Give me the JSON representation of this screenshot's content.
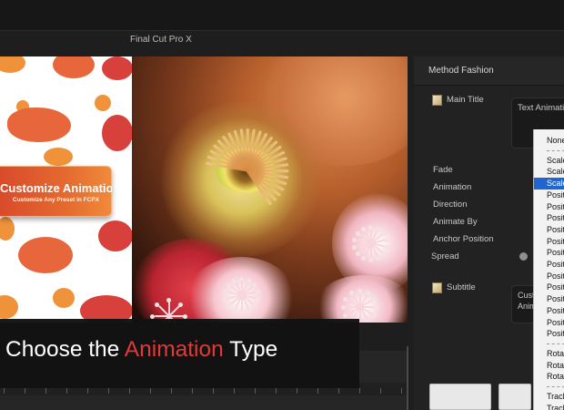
{
  "app": {
    "title": "Final Cut Pro X"
  },
  "template": {
    "card_title": "Customize Animations",
    "card_subtitle": "Customize Any Preset in FCPX"
  },
  "inspector": {
    "title": "Method Fashion",
    "main_title_label": "Main Title",
    "text_box_value": "Text Animation",
    "params": [
      "Fade",
      "Animation",
      "Direction",
      "Animate By",
      "Anchor Position",
      "Spread"
    ],
    "subtitle_label": "Subtitle",
    "subtitle_box_value": "Custom Animation"
  },
  "dropdown": {
    "items": [
      {
        "label": "None",
        "type": "head"
      },
      {
        "label": "",
        "type": "sep"
      },
      {
        "label": "Scale",
        "type": "item"
      },
      {
        "label": "Scale",
        "type": "item"
      },
      {
        "label": "Scale",
        "type": "selected"
      },
      {
        "label": "Position",
        "type": "item"
      },
      {
        "label": "Position",
        "type": "item"
      },
      {
        "label": "Position",
        "type": "item"
      },
      {
        "label": "Position",
        "type": "item"
      },
      {
        "label": "Position",
        "type": "item"
      },
      {
        "label": "Position",
        "type": "item"
      },
      {
        "label": "Position",
        "type": "item"
      },
      {
        "label": "Position",
        "type": "item"
      },
      {
        "label": "Position",
        "type": "item"
      },
      {
        "label": "Position",
        "type": "item"
      },
      {
        "label": "Position",
        "type": "item"
      },
      {
        "label": "Position",
        "type": "item"
      },
      {
        "label": "Position",
        "type": "item"
      },
      {
        "label": "",
        "type": "sep"
      },
      {
        "label": "Rotate",
        "type": "item"
      },
      {
        "label": "Rotate",
        "type": "item"
      },
      {
        "label": "Rotate",
        "type": "item"
      },
      {
        "label": "",
        "type": "sep"
      },
      {
        "label": "Tracking",
        "type": "item"
      },
      {
        "label": "Tracking",
        "type": "item"
      }
    ]
  },
  "caption": {
    "prefix": "Choose the ",
    "highlight": "Animation",
    "suffix": " Type",
    "highlight_color": "#e03a38"
  }
}
